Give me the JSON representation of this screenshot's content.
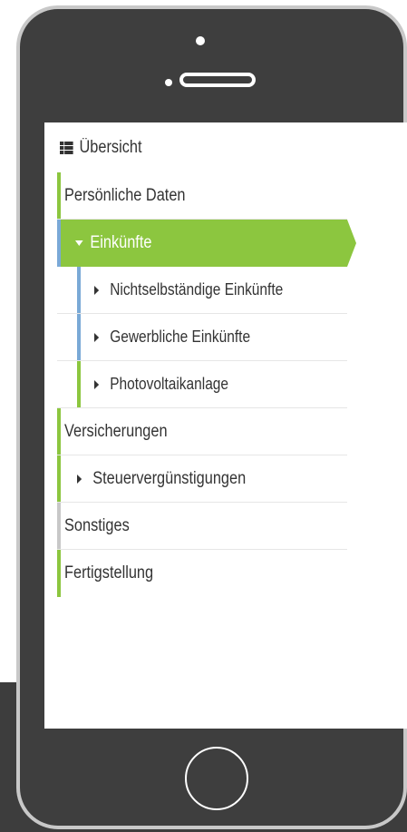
{
  "nav": {
    "overview_label": "Übersicht",
    "items": [
      {
        "label": "Persönliche Daten",
        "bar_color": "#8cc63f"
      },
      {
        "label": "Einkünfte",
        "bar_color": "#7aa9d6",
        "active": true,
        "expanded": true
      },
      {
        "label": "Nichtselbständige Einkünfte",
        "bar_color": "#7aa9d6"
      },
      {
        "label": "Gewerbliche Einkünfte",
        "bar_color": "#7aa9d6"
      },
      {
        "label": "Photovoltaikanlage",
        "bar_color": "#8cc63f"
      },
      {
        "label": "Versicherungen",
        "bar_color": "#8cc63f"
      },
      {
        "label": "Steuervergünstigungen",
        "bar_color": "#8cc63f"
      },
      {
        "label": "Sonstiges",
        "bar_color": "#c8c8c8"
      },
      {
        "label": "Fertigstellung",
        "bar_color": "#8cc63f"
      }
    ]
  },
  "colors": {
    "accent_green": "#8cc63f",
    "accent_blue": "#7aa9d6",
    "phone_body": "#3e3e3e",
    "phone_frame": "#c8c8c8",
    "text": "#333333"
  }
}
